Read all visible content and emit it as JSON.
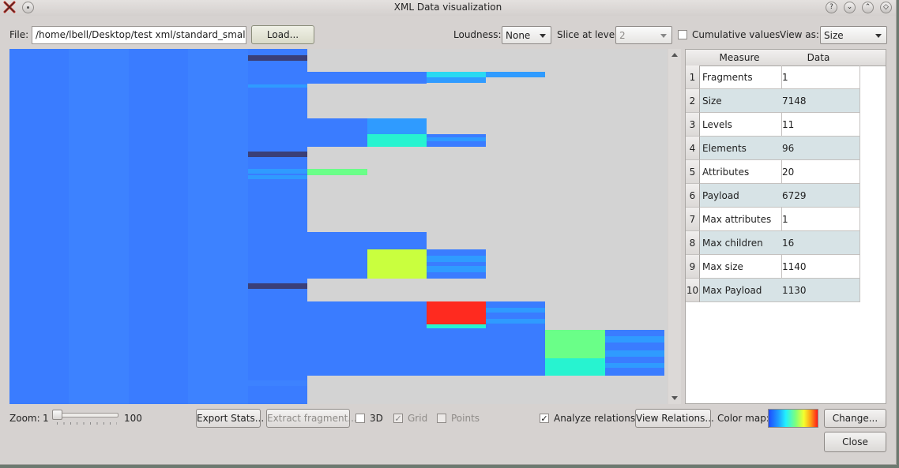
{
  "window": {
    "title": "XML Data visualization"
  },
  "file": {
    "label": "File:",
    "path": "/home/lbell/Desktop/test xml/standard_small.xml",
    "load_label": "Load..."
  },
  "loudness": {
    "label": "Loudness:",
    "value": "None"
  },
  "slice": {
    "label": "Slice at level:",
    "value": "2"
  },
  "cumulative": {
    "label": "Cumulative values",
    "checked": false
  },
  "view_as": {
    "label": "View as:",
    "value": "Size"
  },
  "table": {
    "headers": [
      "Measure",
      "Data"
    ],
    "rows": [
      {
        "num": "1",
        "measure": "Fragments",
        "data": "1"
      },
      {
        "num": "2",
        "measure": "Size",
        "data": "7148"
      },
      {
        "num": "3",
        "measure": "Levels",
        "data": "11"
      },
      {
        "num": "4",
        "measure": "Elements",
        "data": "96"
      },
      {
        "num": "5",
        "measure": "Attributes",
        "data": "20"
      },
      {
        "num": "6",
        "measure": "Payload",
        "data": "6729"
      },
      {
        "num": "7",
        "measure": "Max attributes",
        "data": "1"
      },
      {
        "num": "8",
        "measure": "Max children",
        "data": "16"
      },
      {
        "num": "9",
        "measure": "Max size",
        "data": "1140"
      },
      {
        "num": "10",
        "measure": "Max Payload",
        "data": "1130"
      }
    ]
  },
  "zoom": {
    "label": "Zoom:",
    "min": "1",
    "max": "100",
    "value": 1
  },
  "buttons": {
    "export_stats": "Export Stats...",
    "extract_fragment": "Extract fragment...",
    "view_relations": "View Relations...",
    "change": "Change...",
    "close": "Close"
  },
  "checks": {
    "three_d": {
      "label": "3D",
      "checked": false
    },
    "grid": {
      "label": "Grid",
      "checked": true
    },
    "points": {
      "label": "Points",
      "checked": false
    },
    "analyze_relations": {
      "label": "Analyze relations",
      "checked": true
    }
  },
  "colormap": {
    "label": "Color map:",
    "colors": [
      "#1e4bff",
      "#1f9fff",
      "#22f0ff",
      "#7dff7d",
      "#f5ff2d",
      "#ff9d15",
      "#ff1a1a"
    ]
  },
  "visualization": {
    "colors": {
      "base": "#3a7cff",
      "base2": "#3d82ff",
      "dark": "#3a3f78",
      "mid": "#2f9bff",
      "cyan": "#29d9f2",
      "aqua": "#27f3d0",
      "green": "#6aff88",
      "yellow": "#c9ff3e",
      "red": "#ff2a1f",
      "bg": "#d3d3d3"
    }
  }
}
